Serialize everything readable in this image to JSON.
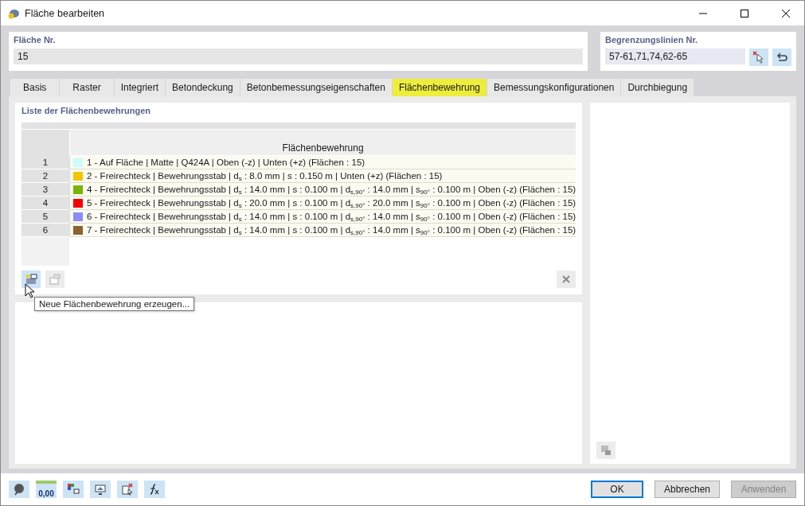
{
  "window": {
    "title": "Fläche bearbeiten"
  },
  "surface_no": {
    "label": "Fläche Nr.",
    "value": "15"
  },
  "boundary_lines": {
    "label": "Begrenzungslinien Nr.",
    "value": "57-61,71,74,62-65"
  },
  "tabs": [
    {
      "label": "Basis",
      "selected": false
    },
    {
      "label": "Raster",
      "selected": false
    },
    {
      "label": "Integriert",
      "selected": false
    },
    {
      "label": "Betondeckung",
      "selected": false
    },
    {
      "label": "Betonbemessungseigenschaften",
      "selected": false
    },
    {
      "label": "Flächenbewehrung",
      "selected": true
    },
    {
      "label": "Bemessungskonfigurationen",
      "selected": false
    },
    {
      "label": "Durchbiegung",
      "selected": false
    }
  ],
  "list": {
    "title": "Liste der Flächenbewehrungen",
    "column": "Flächenbewehrung",
    "rows": [
      {
        "no": "1",
        "color": "#ccfcfc",
        "text": "1 - Auf Fläche | Matte | Q424A | Oben (-z) | Unten (+z) (Flächen : 15)"
      },
      {
        "no": "2",
        "color": "#f4c400",
        "text": "2 - Freirechteck | Bewehrungsstab | d$_{s}$ : 8.0 mm | s : 0.150 m | Unten (+z) (Flächen : 15)"
      },
      {
        "no": "3",
        "color": "#78b400",
        "text": "4 - Freirechteck | Bewehrungsstab | d$_{s}$ : 14.0 mm | s : 0.100 m | d$_{s,90°}$ : 14.0 mm | s$_{90°}$ : 0.100 m | Oben (-z) (Flächen : 15)"
      },
      {
        "no": "4",
        "color": "#f40000",
        "text": "5 - Freirechteck | Bewehrungsstab | d$_{s}$ : 20.0 mm | s : 0.100 m | d$_{s,90°}$ : 20.0 mm | s$_{90°}$ : 0.100 m | Oben (-z) (Flächen : 15)"
      },
      {
        "no": "5",
        "color": "#8c8cfc",
        "text": "6 - Freirechteck | Bewehrungsstab | d$_{s}$ : 14.0 mm | s : 0.100 m | d$_{s,90°}$ : 14.0 mm | s$_{90°}$ : 0.100 m | Oben (-z) (Flächen : 15)"
      },
      {
        "no": "6",
        "color": "#8c6430",
        "text": "7 - Freirechteck | Bewehrungsstab | d$_{s}$ : 14.0 mm | s : 0.100 m | d$_{s,90°}$ : 14.0 mm | s$_{90°}$ : 0.100 m | Oben (-z) (Flächen : 15)"
      }
    ]
  },
  "tooltip": "Neue Flächenbewehrung erzeugen...",
  "units_button": "0,00",
  "buttons": [
    {
      "label": "OK",
      "kind": "default",
      "disabled": false
    },
    {
      "label": "Abbrechen",
      "kind": "normal",
      "disabled": false
    },
    {
      "label": "Anwenden",
      "kind": "normal",
      "disabled": true
    }
  ]
}
